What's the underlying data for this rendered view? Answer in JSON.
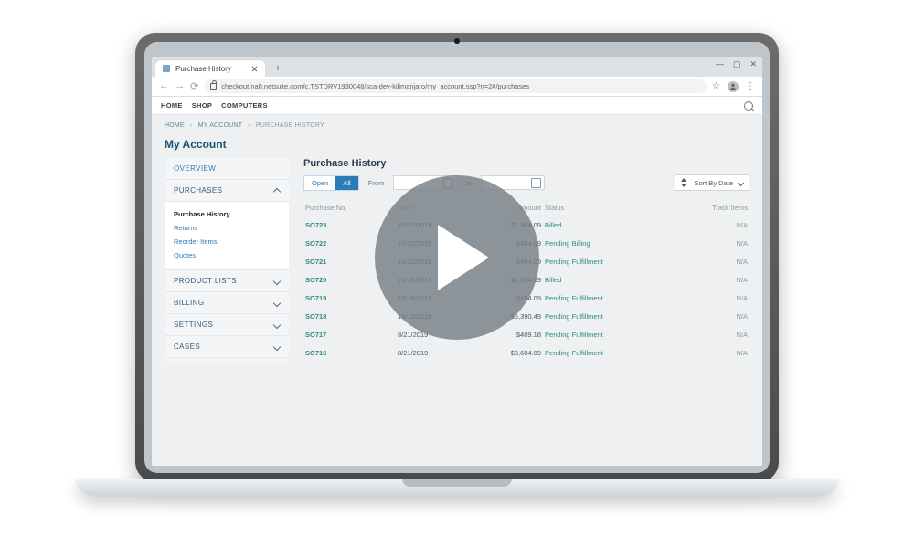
{
  "browser": {
    "tab_title": "Purchase History",
    "url": "checkout.na0.netsuite.com/c.TSTDRV1930048/sca-dev-kilimanjaro/my_account.ssp?n=2#/purchases"
  },
  "sitebar": {
    "items": [
      "HOME",
      "SHOP",
      "COMPUTERS"
    ]
  },
  "crumbs": {
    "home": "HOME",
    "acct": "MY ACCOUNT",
    "cur": "PURCHASE HISTORY"
  },
  "title": "My Account",
  "side": {
    "overview": "OVERVIEW",
    "purchases": "PURCHASES",
    "sub": {
      "ph": "Purchase History",
      "ret": "Returns",
      "re": "Reorder Items",
      "q": "Quotes"
    },
    "productlists": "PRODUCT LISTS",
    "billing": "BILLING",
    "settings": "SETTINGS",
    "cases": "CASES"
  },
  "main": {
    "heading": "Purchase History",
    "filter": {
      "open": "Open",
      "all": "All",
      "from": "From",
      "to": "to",
      "sort": "Sort By Date"
    },
    "cols": {
      "no": "Purchase No.",
      "date": "Date",
      "amt": "Amount",
      "status": "Status",
      "track": "Track Items"
    },
    "rows": [
      {
        "no": "SO723",
        "date": "10/22/2019",
        "amt": "$1,354.09",
        "status": "Billed",
        "track": "N/A"
      },
      {
        "no": "SO722",
        "date": "10/22/2019",
        "amt": "$454.09",
        "status": "Pending Billing",
        "track": "N/A"
      },
      {
        "no": "SO721",
        "date": "10/22/2019",
        "amt": "$454.09",
        "status": "Pending Fulfillment",
        "track": "N/A"
      },
      {
        "no": "SO720",
        "date": "10/18/2019",
        "amt": "$1,354.09",
        "status": "Billed",
        "track": "N/A"
      },
      {
        "no": "SO719",
        "date": "10/16/2019",
        "amt": "$454.09",
        "status": "Pending Fulfillment",
        "track": "N/A"
      },
      {
        "no": "SO718",
        "date": "10/15/2019",
        "amt": "$6,390.49",
        "status": "Pending Fulfillment",
        "track": "N/A"
      },
      {
        "no": "SO717",
        "date": "8/21/2019",
        "amt": "$409.18",
        "status": "Pending Fulfillment",
        "track": "N/A"
      },
      {
        "no": "SO716",
        "date": "8/21/2019",
        "amt": "$3,604.09",
        "status": "Pending Fulfillment",
        "track": "N/A"
      }
    ]
  }
}
